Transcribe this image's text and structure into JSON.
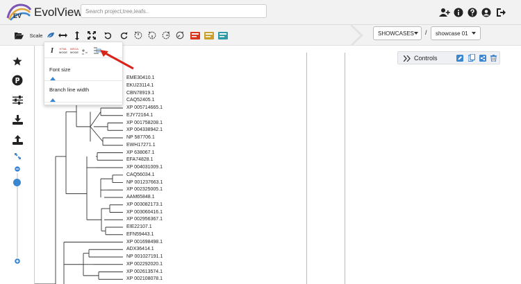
{
  "header": {
    "brand": "EvolView",
    "search_placeholder": "Search project,tree,leafs..",
    "logo_text": "EV"
  },
  "toolbar": {
    "scale_label": "Scale"
  },
  "showcases": {
    "category": "SHOWCASES",
    "separator": "/",
    "item": "showcase 01"
  },
  "popup": {
    "italic_label": "I",
    "html_mode_top": "HTML",
    "html_mode_bottom": "MODE",
    "mega_mode_top": "MEGA",
    "mega_mode_bottom": "MODE",
    "font_size_label": "Font size",
    "branch_line_width_label": "Branch line width"
  },
  "controls": {
    "label": "Controls"
  },
  "tree": {
    "leaves": [
      "EME30410.1",
      "EKU23114.1",
      "CBN78919.1",
      "CAQ52405.1",
      "XP 005714665.1",
      "EJY72164.1",
      "XP 001758208.1",
      "XP 004338942.1",
      "NP 587706.1",
      "EWH17271.1",
      "XP 638067.1",
      "EFA74828.1",
      "XP 004031009.1",
      "CAQ56034.1",
      "NP 001237663.1",
      "XP 002325005.1",
      "AAM65848.1",
      "XP 003082173.1",
      "XP 003060416.1",
      "XP 002956367.1",
      "EIE22107.1",
      "EFN59443.1",
      "XP 001698498.1",
      "ADX36414.1",
      "NP 001027191.1",
      "XP 002292020.1",
      "XP 002613574.1",
      "XP 002108078.1"
    ]
  },
  "colors": {
    "accent": "#3a86d1",
    "arrow": "#d9241c",
    "toolbar_bg": "#f2f2f2"
  }
}
